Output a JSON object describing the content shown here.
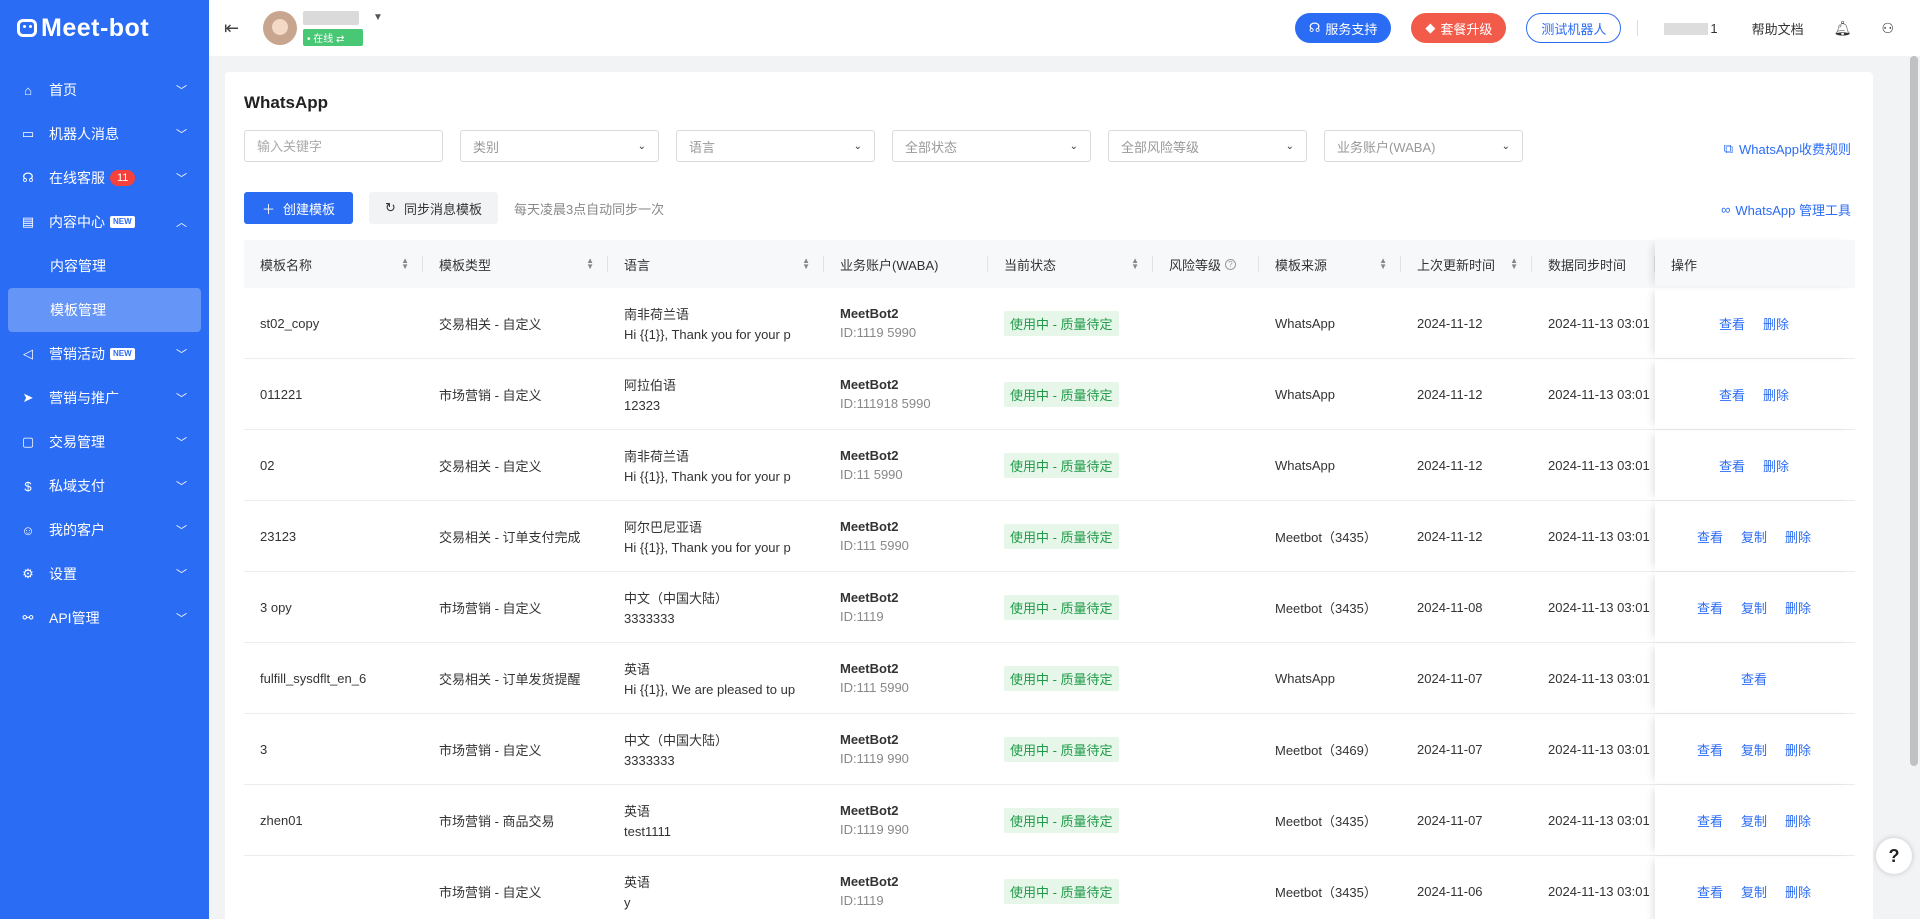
{
  "brand": "Meet-bot",
  "nav": [
    {
      "label": "首页",
      "icon": "home-icon",
      "glyph": "⌂",
      "expanded": false
    },
    {
      "label": "机器人消息",
      "icon": "chat-icon",
      "glyph": "▭",
      "expanded": false
    },
    {
      "label": "在线客服",
      "icon": "headset-icon",
      "glyph": "☊",
      "badge": "11",
      "expanded": false
    },
    {
      "label": "内容中心",
      "icon": "document-icon",
      "glyph": "▤",
      "new": "NEW",
      "expanded": true
    },
    {
      "label": "营销活动",
      "icon": "megaphone-icon",
      "glyph": "◁",
      "new": "NEW",
      "expanded": false
    },
    {
      "label": "营销与推广",
      "icon": "send-icon",
      "glyph": "➤",
      "expanded": false
    },
    {
      "label": "交易管理",
      "icon": "bag-icon",
      "glyph": "▢",
      "expanded": false
    },
    {
      "label": "私域支付",
      "icon": "payment-icon",
      "glyph": "$",
      "expanded": false
    },
    {
      "label": "我的客户",
      "icon": "user-icon",
      "glyph": "☺",
      "expanded": false
    },
    {
      "label": "设置",
      "icon": "gear-icon",
      "glyph": "⚙",
      "expanded": false
    },
    {
      "label": "API管理",
      "icon": "link-icon",
      "glyph": "⚯",
      "expanded": false
    }
  ],
  "content_center_sub": [
    "内容管理",
    "模板管理"
  ],
  "header": {
    "online": "• 在线 ⇄",
    "support": "服务支持",
    "upgrade": "套餐升级",
    "test_bot": "测试机器人",
    "account": "1",
    "help_docs": "帮助文档"
  },
  "page": {
    "title": "WhatsApp",
    "keyword_placeholder": "输入关键字",
    "filters": [
      "类别",
      "语言",
      "全部状态",
      "全部风险等级",
      "业务账户(WABA)"
    ],
    "rules_link": "WhatsApp收费规则",
    "create_btn": "创建模板",
    "sync_btn": "同步消息模板",
    "sync_hint": "每天凌晨3点自动同步一次",
    "tools_link": "WhatsApp 管理工具"
  },
  "table": {
    "headers": [
      "模板名称",
      "模板类型",
      "语言",
      "业务账户(WABA)",
      "当前状态",
      "风险等级",
      "模板来源",
      "上次更新时间",
      "数据同步时间",
      "操作"
    ],
    "rows": [
      {
        "name": "st02_copy",
        "type": "交易相关 - 自定义",
        "lang": "南非荷兰语",
        "preview": "Hi {{1}}, Thank you for your p",
        "waba": "MeetBot2",
        "waba_id": "ID:1119          5990",
        "status": "使用中 - 质量待定",
        "risk": "",
        "source": "WhatsApp",
        "updated": "2024-11-12",
        "synced": "2024-11-13 03:01",
        "ops": [
          "查看",
          "删除"
        ]
      },
      {
        "name": "011221",
        "type": "市场营销 - 自定义",
        "lang": "阿拉伯语",
        "preview": "12323",
        "waba": "MeetBot2",
        "waba_id": "ID:111918      5990",
        "status": "使用中 - 质量待定",
        "risk": "",
        "source": "WhatsApp",
        "updated": "2024-11-12",
        "synced": "2024-11-13 03:01",
        "ops": [
          "查看",
          "删除"
        ]
      },
      {
        "name": "02",
        "type": "交易相关 - 自定义",
        "lang": "南非荷兰语",
        "preview": "Hi {{1}}, Thank you for your p",
        "waba": "MeetBot2",
        "waba_id": "ID:11           5990",
        "status": "使用中 - 质量待定",
        "risk": "",
        "source": "WhatsApp",
        "updated": "2024-11-12",
        "synced": "2024-11-13 03:01",
        "ops": [
          "查看",
          "删除"
        ]
      },
      {
        "name": "23123",
        "type": "交易相关 - 订单支付完成",
        "lang": "阿尔巴尼亚语",
        "preview": "Hi {{1}}, Thank you for your p",
        "waba": "MeetBot2",
        "waba_id": "ID:111          5990",
        "status": "使用中 - 质量待定",
        "risk": "",
        "source": "Meetbot（3435）",
        "updated": "2024-11-12",
        "synced": "2024-11-13 03:01",
        "ops": [
          "查看",
          "复制",
          "删除"
        ]
      },
      {
        "name": "3    opy",
        "type": "市场营销 - 自定义",
        "lang": "中文（中国大陆）",
        "preview": "3333333",
        "waba": "MeetBot2",
        "waba_id": "ID:1119",
        "status": "使用中 - 质量待定",
        "risk": "",
        "source": "Meetbot（3435）",
        "updated": "2024-11-08",
        "synced": "2024-11-13 03:01",
        "ops": [
          "查看",
          "复制",
          "删除"
        ]
      },
      {
        "name": "fulfill_sysdflt_en_6",
        "type": "交易相关 - 订单发货提醒",
        "lang": "英语",
        "preview": "Hi {{1}}, We are pleased to up",
        "waba": "MeetBot2",
        "waba_id": "ID:111          5990",
        "status": "使用中 - 质量待定",
        "risk": "",
        "source": "WhatsApp",
        "updated": "2024-11-07",
        "synced": "2024-11-13 03:01",
        "ops": [
          "查看"
        ]
      },
      {
        "name": "3",
        "type": "市场营销 - 自定义",
        "lang": "中文（中国大陆）",
        "preview": "3333333",
        "waba": "MeetBot2",
        "waba_id": "ID:1119         990",
        "status": "使用中 - 质量待定",
        "risk": "",
        "source": "Meetbot（3469）",
        "updated": "2024-11-07",
        "synced": "2024-11-13 03:01",
        "ops": [
          "查看",
          "复制",
          "删除"
        ]
      },
      {
        "name": "zhen01",
        "type": "市场营销 - 商品交易",
        "lang": "英语",
        "preview": "test1111",
        "waba": "MeetBot2",
        "waba_id": "ID:1119         990",
        "status": "使用中 - 质量待定",
        "risk": "",
        "source": "Meetbot（3435）",
        "updated": "2024-11-07",
        "synced": "2024-11-13 03:01",
        "ops": [
          "查看",
          "复制",
          "删除"
        ]
      },
      {
        "name": "",
        "type": "市场营销 - 自定义",
        "lang": "英语",
        "preview": "y",
        "waba": "MeetBot2",
        "waba_id": "ID:1119",
        "status": "使用中 - 质量待定",
        "risk": "",
        "source": "Meetbot（3435）",
        "updated": "2024-11-06",
        "synced": "2024-11-13 03:01",
        "ops": [
          "查看",
          "复制",
          "删除"
        ]
      }
    ]
  },
  "colors": {
    "primary": "#2b6cf5",
    "danger": "#f25a4a",
    "success_bg": "#e6f7ea",
    "success": "#1f9a47"
  }
}
